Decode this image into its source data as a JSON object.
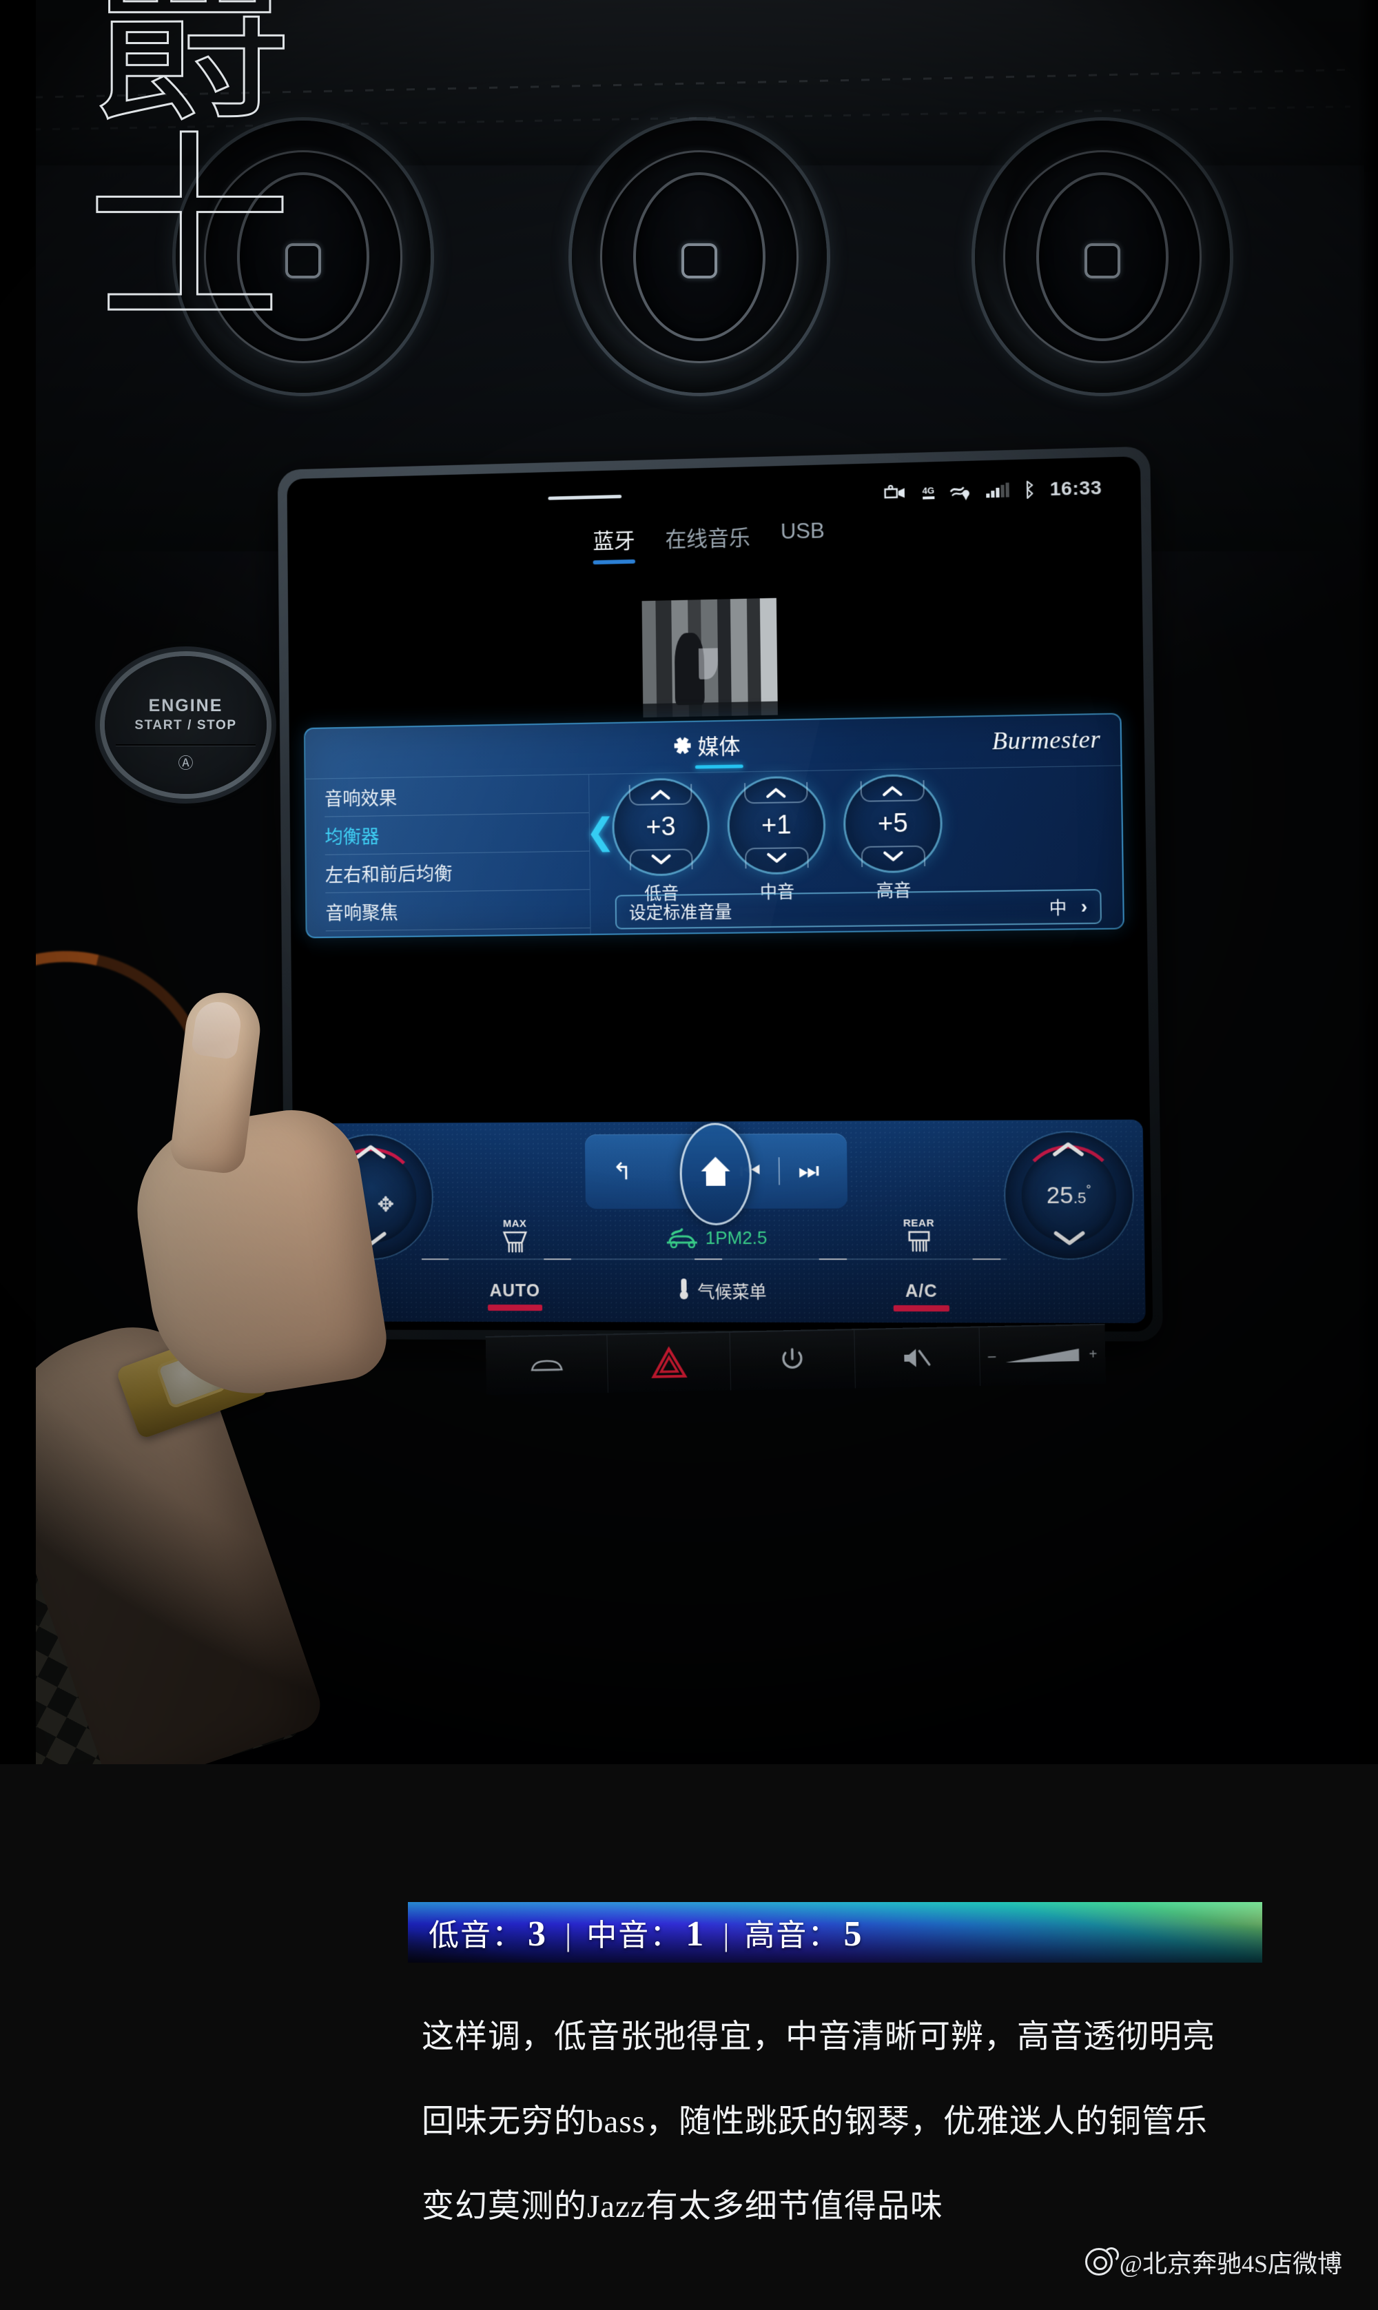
{
  "status_bar": {
    "icons": [
      "dashcam-icon",
      "4g-signal-icon",
      "navigation-icon",
      "cellular-bars-icon",
      "bluetooth-icon"
    ],
    "network_label": "4G",
    "clock": "16:33"
  },
  "source_tabs": [
    {
      "label": "蓝牙",
      "active": true
    },
    {
      "label": "在线音乐",
      "active": false
    },
    {
      "label": "USB",
      "active": false
    }
  ],
  "media_panel": {
    "title": "媒体",
    "brand": "Burmester",
    "menu": [
      {
        "label": "音响效果",
        "active": false
      },
      {
        "label": "均衡器",
        "active": true
      },
      {
        "label": "左右和前后均衡",
        "active": false
      },
      {
        "label": "音响聚焦",
        "active": false
      },
      {
        "label": "设",
        "active": false
      }
    ],
    "equalizer": {
      "steppers": [
        {
          "label": "低音",
          "value": "+3"
        },
        {
          "label": "中音",
          "value": "+1"
        },
        {
          "label": "高音",
          "value": "+5"
        }
      ]
    },
    "standard_volume": {
      "label": "设定标准音量",
      "value": "中",
      "chevron": "›"
    }
  },
  "climate_bar": {
    "shortcuts": [
      "back-icon",
      "home-icon",
      "previous-track-icon",
      "next-track-icon"
    ],
    "back_glyph": "↰",
    "home_glyph": "⌂",
    "prev_glyph": "⏮",
    "next_glyph": "⏭",
    "fan_dial": {
      "glyph": "✥",
      "name": "fan-speed-dial"
    },
    "temp_dial": {
      "value": "25",
      "decimal": ".5",
      "degree": "°"
    },
    "front_defrost": {
      "caption": "MAX",
      "glyph": "▽"
    },
    "air_quality": {
      "label": "1PM2.5",
      "prefix": "1",
      "suffix": "PM2.5",
      "color": "#3ddb92"
    },
    "rear_defrost": {
      "caption": "REAR",
      "glyph": "▽"
    },
    "bottom_controls": [
      {
        "label": "AUTO",
        "on": true
      },
      {
        "label": "气候菜单",
        "on": false,
        "icon": "thermometer-icon"
      },
      {
        "label": "A/C",
        "on": true
      }
    ]
  },
  "hard_keys": [
    {
      "name": "vehicle-icon",
      "glyph": "⬡"
    },
    {
      "name": "hazard-icon",
      "glyph": "△"
    },
    {
      "name": "power-icon",
      "glyph": "⏻"
    },
    {
      "name": "mute-icon",
      "glyph": "🔇"
    },
    {
      "name": "volume-slider",
      "minus": "–",
      "plus": "+"
    }
  ],
  "dashboard": {
    "engine_button": {
      "line1": "ENGINE",
      "line2": "START / STOP",
      "eco_glyph": "Ⓐ"
    },
    "vents": [
      "vent-left",
      "vent-center",
      "vent-right"
    ]
  },
  "caption": {
    "jazz_characters": [
      "爵",
      "士"
    ],
    "eq_banner": {
      "items": [
        {
          "key": "低音：",
          "value": "3"
        },
        {
          "key": "中音：",
          "value": "1"
        },
        {
          "key": "高音：",
          "value": "5"
        }
      ],
      "separator": "|"
    },
    "lines": [
      "这样调，低音张弛得宜，中音清晰可辨，高音透彻明亮",
      "回味无穷的bass，随性跳跃的钢琴，优雅迷人的铜管乐",
      "变幻莫测的Jazz有太多细节值得品味"
    ],
    "watermark": "@北京奔驰4S店微博"
  },
  "colors": {
    "accent_cyan": "#25c3f0",
    "tab_underline_blue": "#2b7fd4",
    "climate_red": "#e81c49",
    "air_green": "#3ddb92",
    "panel_blue": "#0d3a76"
  }
}
